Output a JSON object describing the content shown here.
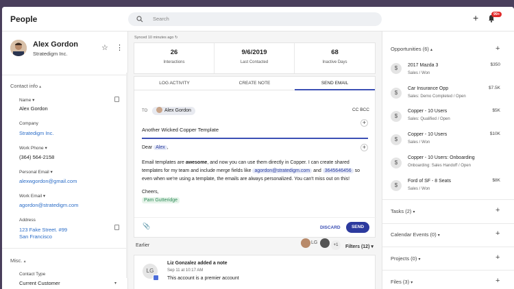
{
  "header": {
    "title": "People",
    "search_placeholder": "Search",
    "notification_count": "99+"
  },
  "contact": {
    "name": "Alex Gordon",
    "company": "Stratedigm Inc.",
    "section_title": "Contact info",
    "fields": [
      {
        "label": "Name",
        "value": "Alex Gordon"
      },
      {
        "label": "Company",
        "value": "Stratedigm Inc."
      },
      {
        "label": "Work Phone",
        "value": "(364) 564-2158"
      },
      {
        "label": "Personal Email",
        "value": "alexwgordon@gmail.com"
      },
      {
        "label": "Work Email",
        "value": "agordon@stratedigm.com"
      },
      {
        "label": "Address",
        "line1": "123 Fake Street. #99",
        "line2": "San Francisco"
      }
    ],
    "misc_title": "Misc.",
    "contact_type_label": "Contact Type",
    "contact_type_value": "Current Customer"
  },
  "sync_status": "Synced 10 minutes ago",
  "stats": [
    {
      "value": "26",
      "label": "Interactions"
    },
    {
      "value": "9/6/2019",
      "label": "Last Contacted"
    },
    {
      "value": "68",
      "label": "Inactive Days"
    }
  ],
  "composer": {
    "tabs": [
      "LOG ACTIVITY",
      "CREATE NOTE",
      "SEND EMAIL"
    ],
    "to_label": "TO",
    "to_recipient": "Alex Gordon",
    "cc_bcc": "CC  BCC",
    "subject": "Another Wicked Copper Template",
    "greeting_prefix": "Dear",
    "greeting_field": "Alex",
    "greeting_suffix": ",",
    "body_line1_a": "Email templates are ",
    "body_line1_bold": "awesome",
    "body_line1_b": ", and now you can use them directly in Copper. I can create shared",
    "body_line2_a": "templates for my team and include merge fields like",
    "merge_email": "agordon@stratedigm.com",
    "body_line2_and": "and",
    "merge_phone": "3645646456",
    "body_line2_so": "so",
    "body_line3": "even when we're using a template, the emails are always personalized. You can't miss out on this!",
    "signoff": "Cheers,",
    "signature": "Pam Gutteridge",
    "discard_label": "DISCARD",
    "send_label": "SEND"
  },
  "activity": {
    "earlier_label": "Earlier",
    "avatar_initials": "LG",
    "more_count": "+1",
    "filters_label": "Filters (12)",
    "items": [
      {
        "initials": "LG",
        "title": "Liz Gonzalez added a note",
        "time": "Sep 11 at 10:17 AM",
        "text": "This account is a premier account"
      }
    ]
  },
  "opportunities": {
    "title": "Opportunities (6)",
    "items": [
      {
        "name": "2017 Mazda 3",
        "status": "Sales / Won",
        "amount": "$350"
      },
      {
        "name": "Car Insurance Opp",
        "status": "Sales: Demo Completed / Open",
        "amount": "$7.5K"
      },
      {
        "name": "Copper - 10 Users",
        "status": "Sales: Qualified / Open",
        "amount": "$5K"
      },
      {
        "name": "Copper - 10 Users",
        "status": "Sales / Won",
        "amount": "$10K"
      },
      {
        "name": "Copper - 10 Users: Onboarding",
        "status": "Onboarding: Sales Handoff / Open",
        "amount": ""
      },
      {
        "name": "Ford of SF - 8 Seats",
        "status": "Sales / Won",
        "amount": "$8K"
      }
    ]
  },
  "related": [
    {
      "title": "Tasks (2)"
    },
    {
      "title": "Calendar Events (0)"
    },
    {
      "title": "Projects (0)"
    },
    {
      "title": "Files (3)"
    }
  ]
}
